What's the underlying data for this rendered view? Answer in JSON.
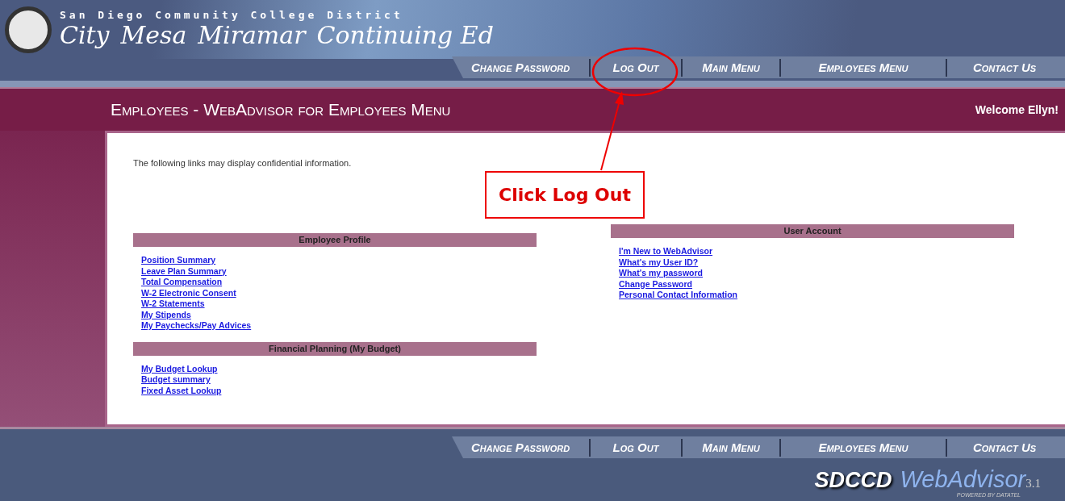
{
  "header": {
    "district": "San Diego Community College District",
    "colleges": [
      "City",
      "Mesa",
      "Miramar",
      "Continuing Ed"
    ],
    "nav": [
      "Change Password",
      "Log Out",
      "Main Menu",
      "Employees Menu",
      "Contact Us"
    ]
  },
  "title_bar": {
    "title": "Employees - WebAdvisor for Employees Menu",
    "welcome": "Welcome Ellyn!"
  },
  "notice": "The following links may display confidential information.",
  "columns": [
    {
      "sections": [
        {
          "heading": "Employee Profile",
          "links": [
            "Position Summary",
            "Leave Plan Summary",
            "Total Compensation",
            "W-2 Electronic Consent",
            "W-2 Statements",
            "My Stipends",
            "My Paychecks/Pay Advices"
          ]
        },
        {
          "heading": "Financial Planning (My Budget)",
          "links": [
            "My Budget Lookup",
            "Budget summary",
            "Fixed Asset Lookup"
          ]
        }
      ]
    },
    {
      "sections": [
        {
          "heading": "User Account",
          "links": [
            "I'm New to WebAdvisor",
            "What's my User ID?",
            "What's my password",
            "Change Password",
            "Personal Contact Information"
          ]
        }
      ]
    }
  ],
  "footer": {
    "nav": [
      "Change Password",
      "Log Out",
      "Main Menu",
      "Employees Menu",
      "Contact Us"
    ],
    "brand": "SDCCD",
    "product": "WebAdvisor",
    "version": "3.1",
    "powered": "POWERED BY DATATEL"
  },
  "annotation": {
    "callout": "Click Log Out"
  }
}
